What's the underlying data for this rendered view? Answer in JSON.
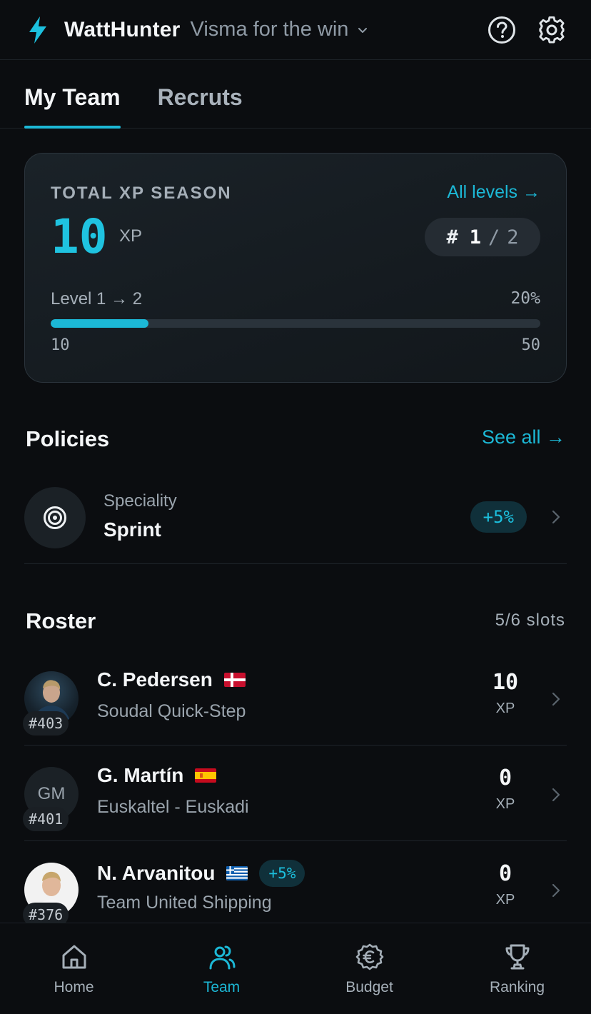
{
  "header": {
    "app_title": "WattHunter",
    "team_name": "Visma for the win",
    "icons": [
      "bolt-icon",
      "chevron-down-icon",
      "help-icon",
      "settings-icon"
    ]
  },
  "tabs": [
    {
      "label": "My Team",
      "active": true
    },
    {
      "label": "Recruts",
      "active": false
    }
  ],
  "xp_card": {
    "label": "TOTAL XP SEASON",
    "all_levels": "All levels →",
    "value": "10",
    "unit": "XP",
    "rank_hash": "#",
    "rank_current": "1",
    "rank_slash": "/",
    "rank_total": "2",
    "level_label": "Level 1 → 2",
    "level_percent": "20%",
    "progress": 0.2,
    "bar_min": "10",
    "bar_max": "50"
  },
  "policies": {
    "title": "Policies",
    "see_all": "See all →",
    "item": {
      "subtitle": "Speciality",
      "name": "Sprint",
      "badge": "+5%"
    }
  },
  "roster": {
    "title": "Roster",
    "slots": "5/6 slots",
    "riders": [
      {
        "name": "C. Pedersen",
        "team": "Soudal Quick-Step",
        "rank": "#403",
        "xp": "10",
        "xp_unit": "XP",
        "flag": "denmark-flag",
        "avatar": "photo"
      },
      {
        "name": "G. Martín",
        "team": "Euskaltel - Euskadi",
        "rank": "#401",
        "xp": "0",
        "xp_unit": "XP",
        "flag": "spain-flag",
        "initials": "GM"
      },
      {
        "name": "N. Arvanitou",
        "team": "Team United Shipping",
        "rank": "#376",
        "xp": "0",
        "xp_unit": "XP",
        "flag": "greece-flag",
        "badge": "+5%",
        "avatar": "photo"
      }
    ]
  },
  "nav": [
    {
      "label": "Home",
      "icon": "home-icon",
      "active": false
    },
    {
      "label": "Team",
      "icon": "team-icon",
      "active": true
    },
    {
      "label": "Budget",
      "icon": "euro-icon",
      "active": false
    },
    {
      "label": "Ranking",
      "icon": "trophy-icon",
      "active": false
    }
  ],
  "colors": {
    "background": "#0b0d10",
    "accent": "#1cb8d6",
    "card": "#161d22",
    "muted": "#a5afb8"
  }
}
